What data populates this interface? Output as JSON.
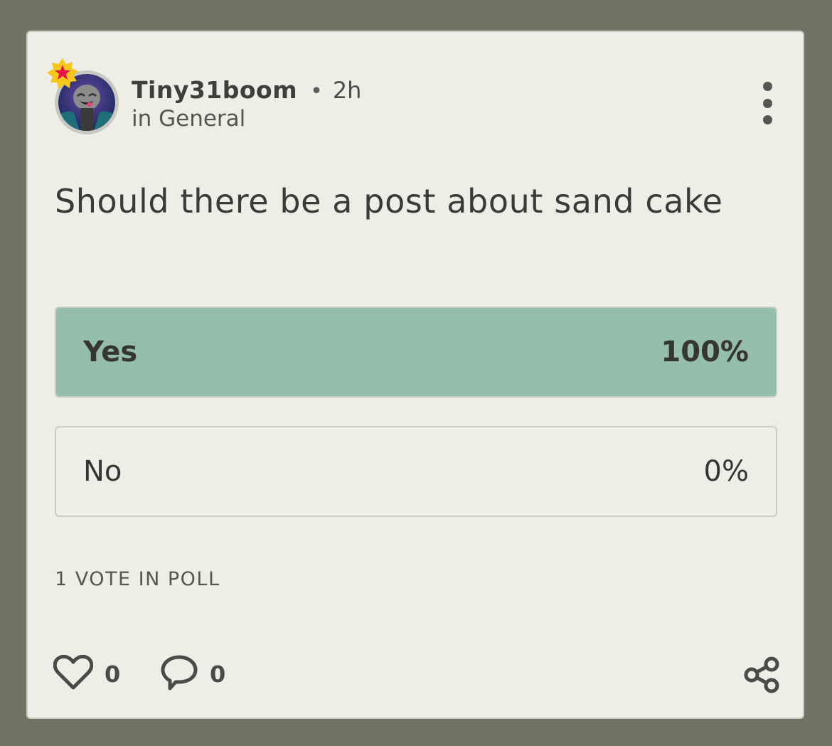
{
  "post": {
    "author": "Tiny31boom",
    "separator": "•",
    "time": "2h",
    "category": "in General",
    "title": "Should there be a post about sand cake"
  },
  "poll": {
    "options": [
      {
        "label": "Yes",
        "percent_text": "100%",
        "percent": 100,
        "selected": true
      },
      {
        "label": "No",
        "percent_text": "0%",
        "percent": 0,
        "selected": false
      }
    ],
    "votes_text": "1 VOTE IN POLL"
  },
  "actions": {
    "like_count": "0",
    "comment_count": "0",
    "like_icon": "heart-icon",
    "comment_icon": "speech-bubble-icon",
    "share_icon": "share-icon",
    "more_icon": "more-vertical-icon"
  },
  "colors": {
    "page_background": "#717465",
    "card_background": "#eeeee7",
    "poll_fill": "#95bdab",
    "badge_star": "#e8124a",
    "badge_burst": "#f6c71c"
  }
}
